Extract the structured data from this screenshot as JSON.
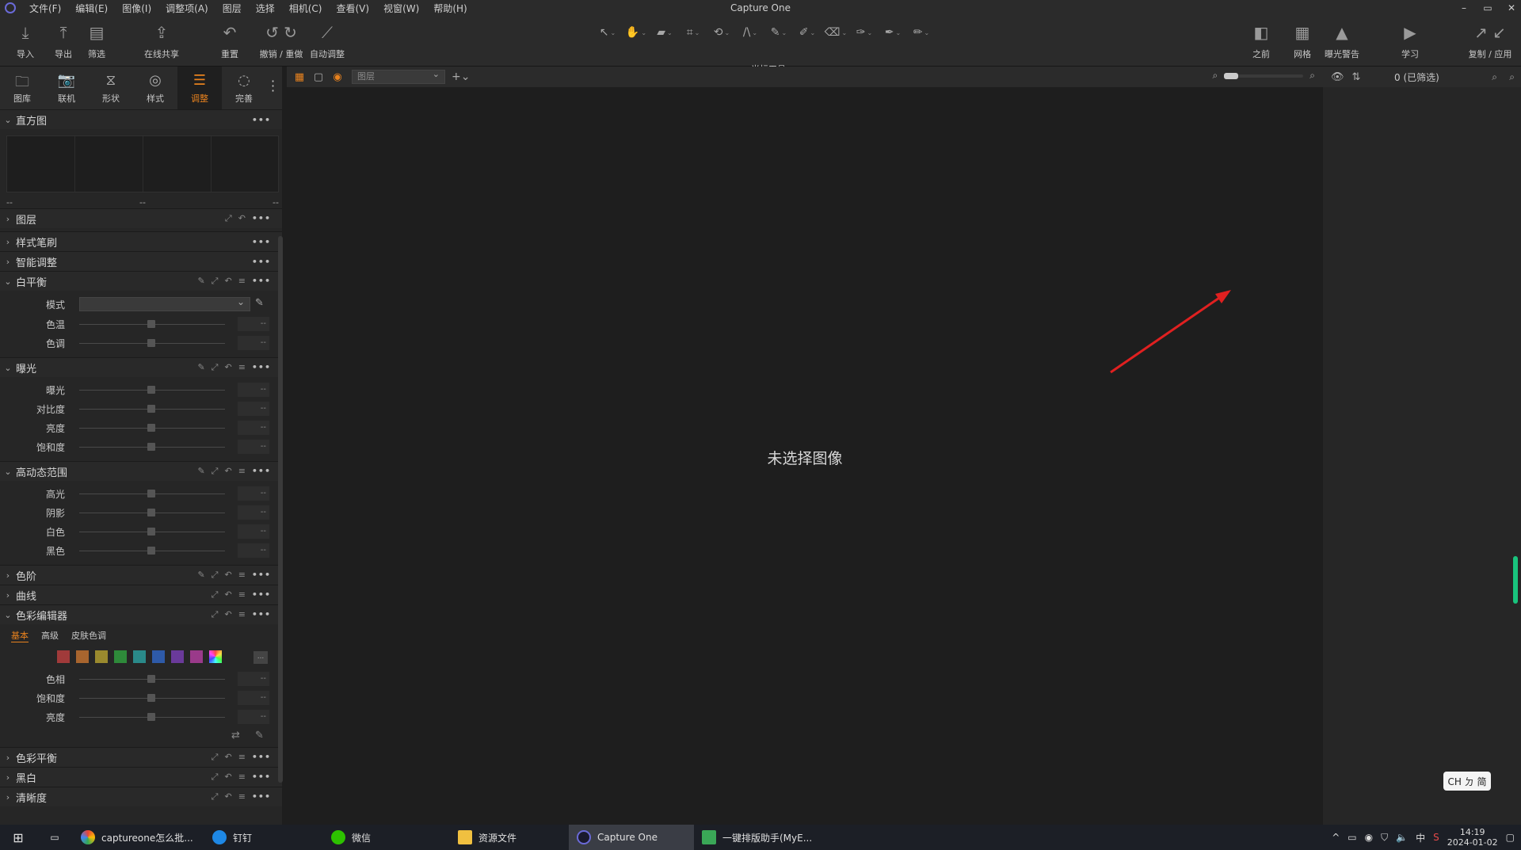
{
  "app": {
    "title": "Capture One",
    "menu": [
      "文件(F)",
      "编辑(E)",
      "图像(I)",
      "调整项(A)",
      "图层",
      "选择",
      "相机(C)",
      "查看(V)",
      "视窗(W)",
      "帮助(H)"
    ],
    "window_controls": [
      "–",
      "▭",
      "✕"
    ]
  },
  "toolbar": {
    "import_label": "导入",
    "export_label": "导出",
    "filter_label": "筛选",
    "share_label": "在线共享",
    "reset_label": "重置",
    "undo_redo_label": "撤销 / 重做",
    "auto_adjust_label": "自动调整",
    "cursor_tools_label": "光标工具",
    "before_label": "之前",
    "grid_label": "网格",
    "exposure_warning_label": "曝光警告",
    "learn_label": "学习",
    "copy_apply_label": "复制 / 应用"
  },
  "tool_tabs": [
    {
      "label": "图库",
      "icon": "folder-icon"
    },
    {
      "label": "联机",
      "icon": "camera-icon"
    },
    {
      "label": "形状",
      "icon": "shape-icon"
    },
    {
      "label": "样式",
      "icon": "style-icon"
    },
    {
      "label": "调整",
      "icon": "adjust-icon",
      "active": true
    },
    {
      "label": "完善",
      "icon": "refine-icon"
    }
  ],
  "histogram": {
    "title": "直方图",
    "left_value": "--",
    "mid_value": "--",
    "right_value": "--"
  },
  "sections": {
    "layers": "图层",
    "style_brush": "样式笔刷",
    "smart_adjust": "智能调整",
    "white_balance": {
      "title": "白平衡",
      "mode_label": "模式",
      "sliders": [
        "色温",
        "色调"
      ]
    },
    "exposure": {
      "title": "曝光",
      "sliders": [
        "曝光",
        "对比度",
        "亮度",
        "饱和度"
      ]
    },
    "hdr": {
      "title": "高动态范围",
      "sliders": [
        "高光",
        "阴影",
        "白色",
        "黑色"
      ]
    },
    "levels": "色阶",
    "curves": "曲线",
    "color_editor": {
      "title": "色彩编辑器",
      "tabs": [
        "基本",
        "高级",
        "皮肤色调"
      ],
      "sliders": [
        "色相",
        "饱和度",
        "亮度"
      ]
    },
    "color_balance": "色彩平衡",
    "bw": "黑白",
    "clarity": "清晰度",
    "slider_value": "--",
    "more_button": "...",
    "more_dots": "•••"
  },
  "colors": {
    "accent": "#e8821e",
    "swatches": [
      "#a03a3a",
      "#a8652e",
      "#9a8a2e",
      "#2e8a3a",
      "#2a8a8a",
      "#2e5aa8",
      "#6a3a9a",
      "#9a3a8a"
    ]
  },
  "viewer": {
    "layer_select": "图层",
    "empty_message": "未选择图像"
  },
  "browser": {
    "count_label": "0 (已筛选)"
  },
  "ime": {
    "label": "CH ㄉ 简"
  },
  "taskbar": {
    "items": [
      "captureone怎么批...",
      "钉钉",
      "微信",
      "资源文件",
      "Capture One",
      "一键排版助手(MyE..."
    ],
    "tray_lang": "中",
    "time": "14:19",
    "date": "2024-01-02"
  }
}
